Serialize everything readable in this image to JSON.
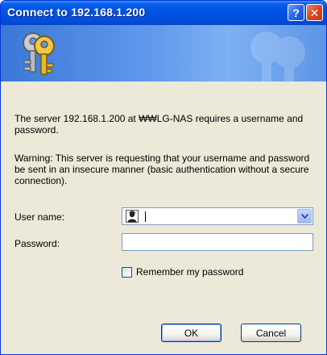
{
  "window": {
    "title": "Connect to 192.168.1.200",
    "help_glyph": "?",
    "close_glyph": "✕"
  },
  "icons": {
    "banner": "keys-icon",
    "user": "user-icon",
    "dropdown": "chevron-down-icon"
  },
  "message": {
    "intro": "The server 192.168.1.200 at ₩₩LG-NAS requires a username and password.",
    "warning": "Warning: This server is requesting that your username and password be sent in an insecure manner (basic authentication without a secure connection)."
  },
  "form": {
    "username_label": "User name:",
    "username_value": "",
    "password_label": "Password:",
    "password_value": "",
    "remember_label": "Remember my password",
    "remember_checked": false
  },
  "buttons": {
    "ok": "OK",
    "cancel": "Cancel"
  },
  "colors": {
    "titlebar": "#0054e3",
    "dialog_bg": "#ece9d8",
    "banner": "#5f98ec",
    "close_button": "#d6472a"
  }
}
